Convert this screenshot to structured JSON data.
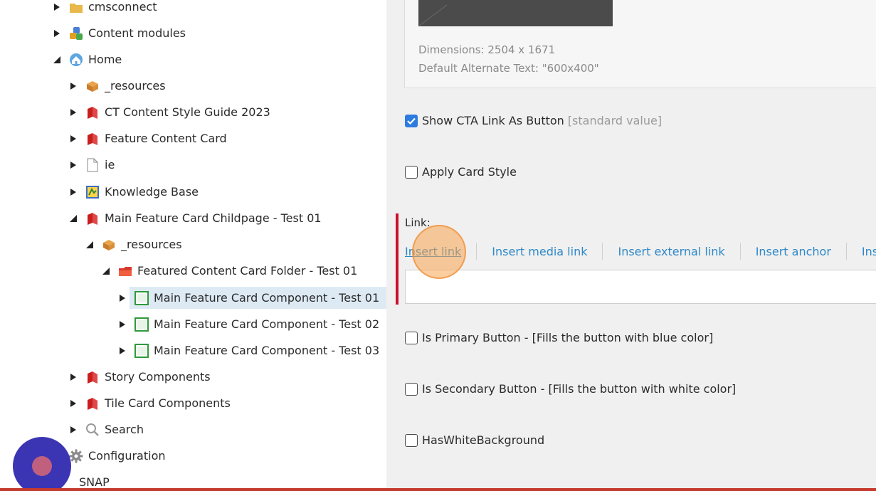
{
  "tree": {
    "items": [
      {
        "label": "cmsconnect",
        "expanded": false,
        "icon": "folder-icon"
      },
      {
        "label": "Content modules",
        "expanded": false,
        "icon": "modules-icon"
      },
      {
        "label": "Home",
        "expanded": true,
        "icon": "home-icon"
      },
      {
        "label": "_resources",
        "expanded": false,
        "icon": "resources-icon"
      },
      {
        "label": "CT Content Style Guide 2023",
        "expanded": false,
        "icon": "red-book-icon"
      },
      {
        "label": "Feature Content Card",
        "expanded": false,
        "icon": "red-book-icon"
      },
      {
        "label": "ie",
        "expanded": false,
        "icon": "document-icon"
      },
      {
        "label": "Knowledge Base",
        "expanded": false,
        "icon": "knowledge-base-icon"
      },
      {
        "label": "Main Feature Card Childpage - Test 01",
        "expanded": true,
        "icon": "red-book-icon"
      },
      {
        "label": "_resources",
        "expanded": true,
        "icon": "resources-icon"
      },
      {
        "label": "Featured Content Card Folder - Test 01",
        "expanded": true,
        "icon": "red-folder-icon"
      },
      {
        "label": "Main Feature Card Component - Test 01",
        "expanded": false,
        "icon": "component-icon",
        "selected": true
      },
      {
        "label": "Main Feature Card Component - Test 02",
        "expanded": false,
        "icon": "component-icon"
      },
      {
        "label": "Main Feature Card Component - Test 03",
        "expanded": false,
        "icon": "component-icon"
      },
      {
        "label": "Story Components",
        "expanded": false,
        "icon": "red-book-icon"
      },
      {
        "label": "Tile Card Components",
        "expanded": false,
        "icon": "red-book-icon"
      },
      {
        "label": "Search",
        "expanded": false,
        "icon": "search-icon"
      },
      {
        "label": "Configuration",
        "expanded": false,
        "icon": "gear-icon"
      },
      {
        "label": "SNAP",
        "expanded": false,
        "icon": "snap-icon"
      }
    ]
  },
  "image_field": {
    "dimensions": "Dimensions: 2504 x 1671",
    "alt_text": "Default Alternate Text: \"600x400\""
  },
  "fields": {
    "show_cta": {
      "label": "Show CTA Link As Button",
      "note": "[standard value]",
      "checked": true
    },
    "apply_card_style": {
      "label": "Apply Card Style",
      "checked": false
    },
    "link": {
      "label": "Link:",
      "actions": [
        "Insert link",
        "Insert media link",
        "Insert external link",
        "Insert anchor",
        "Ins"
      ],
      "value": ""
    },
    "is_primary": {
      "label": "Is Primary Button - [Fills the button with blue color]",
      "checked": false
    },
    "is_secondary": {
      "label": "Is Secondary Button - [Fills the button with white color]",
      "checked": false
    },
    "has_white_bg": {
      "label": "HasWhiteBackground",
      "checked": false
    }
  },
  "colors": {
    "link_blue": "#2d88c8",
    "required_red": "#c8102e",
    "selection_bg": "#ddeaf4",
    "checkbox_blue": "#2d7be0",
    "record_button": "#3b35b4"
  }
}
